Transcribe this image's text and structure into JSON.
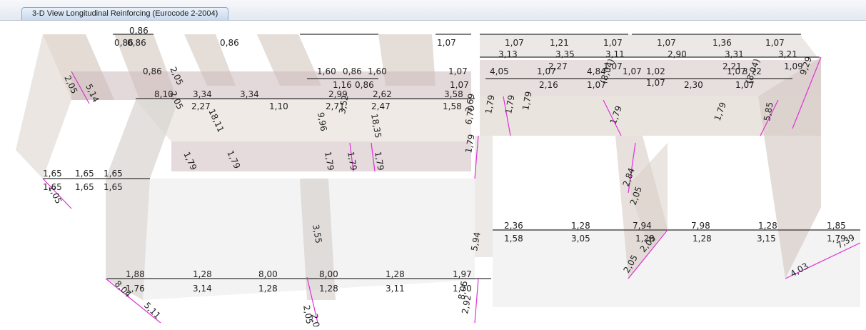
{
  "window": {
    "tab_title": "3-D View  Longitudinal Reinforcing  (Eurocode 2-2004)"
  },
  "labels": [
    "0,86",
    "0,86",
    "0,86",
    "1,07",
    "1,07",
    "1,21",
    "1,07",
    "1,07",
    "1,36",
    "1,07",
    "3,13",
    "3,35",
    "3,11",
    "2,90",
    "3,31",
    "3,21",
    "2,27",
    "1,07",
    "2,21",
    "1,09",
    "0,86",
    "2,05",
    "1,60",
    "0,86",
    "1,60",
    "1,07",
    "4,05",
    "1,07",
    "4,84",
    "1,07",
    "1,02",
    "1,07",
    "3,72",
    "2,05",
    "5,14",
    "1,16",
    "0,86",
    "1,07",
    "2,16",
    "1,07",
    "(8,04)",
    "1,07",
    "2,30",
    "1,07",
    "(8,04)",
    "9,29",
    "8,10",
    "3,34",
    "3,34",
    "2,99",
    "2,62",
    "3,58",
    "2,27",
    "1,10",
    "2,71",
    "2,47",
    "1,58",
    "18,11",
    "9,96",
    "3,52",
    "18,35",
    "3,69",
    "6,70",
    "5,85",
    "1,79",
    "1,79",
    "1,79",
    "1,79",
    "1,79",
    "1,79",
    "1,79",
    "1,79",
    "1,79",
    "1,79",
    "1,79",
    "1,65",
    "1,65",
    "1,65",
    "1,65",
    "1,65",
    "1,65",
    "2,05",
    "2,84",
    "2,05",
    "2,36",
    "1,28",
    "7,94",
    "7,98",
    "1,28",
    "1,85",
    "1,58",
    "3,05",
    "1,28",
    "1,28",
    "3,15",
    "1,79",
    "7,39",
    "2,05",
    "3,55",
    "5,94",
    "1,88",
    "1,28",
    "8,00",
    "8,00",
    "1,28",
    "1,97",
    "1,76",
    "3,14",
    "1,28",
    "1,28",
    "3,11",
    "1,70",
    "8,04",
    "5,11",
    "2,05",
    "2,05",
    "8,05",
    "2,92",
    "2,05",
    "4,03",
    "0,86",
    "2,05"
  ]
}
